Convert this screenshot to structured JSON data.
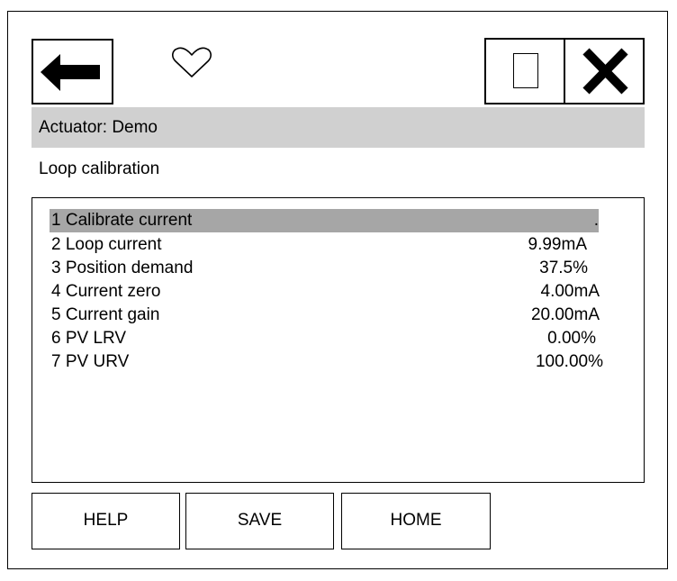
{
  "header": {
    "back_icon": "arrow-left-icon",
    "favorite_icon": "heart-outline-icon",
    "window_icon": "window-icon",
    "close_icon": "close-x-icon"
  },
  "device": {
    "title": "Actuator: Demo"
  },
  "page": {
    "title": "Loop calibration"
  },
  "menu": {
    "items": [
      {
        "label": "1 Calibrate current",
        "value": "."
      },
      {
        "label": "2 Loop current",
        "value": "9.99mA"
      },
      {
        "label": "3 Position demand",
        "value": "37.5%"
      },
      {
        "label": "4 Current zero",
        "value": "4.00mA"
      },
      {
        "label": "5 Current gain",
        "value": "20.00mA"
      },
      {
        "label": "6 PV LRV",
        "value": "0.00%"
      },
      {
        "label": "7 PV URV",
        "value": "100.00%"
      }
    ],
    "selected_index": 0
  },
  "footer": {
    "help_label": "HELP",
    "save_label": "SAVE",
    "home_label": "HOME"
  },
  "colors": {
    "title_bar": "#d0d0d0",
    "selected_row": "#a6a6a6"
  }
}
